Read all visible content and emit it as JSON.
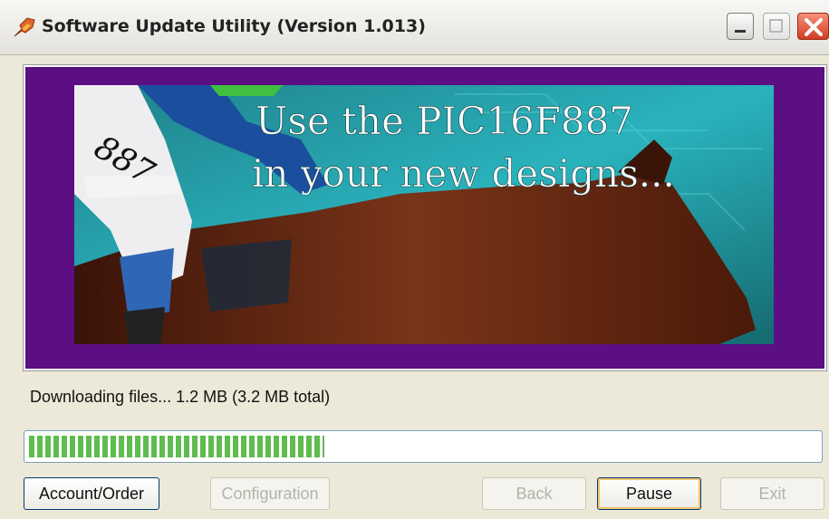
{
  "window": {
    "title": "Software Update Utility (Version 1.013)"
  },
  "banner": {
    "line1": "Use the PIC16F887",
    "line2": "in your new designs...",
    "jersey_number": "887"
  },
  "status": {
    "text": "Downloading files... 1.2 MB (3.2 MB total)",
    "downloaded_mb": 1.2,
    "total_mb": 3.2,
    "progress_fraction": 0.375
  },
  "buttons": {
    "account_order": "Account/Order",
    "configuration": "Configuration",
    "back": "Back",
    "pause": "Pause",
    "exit": "Exit"
  },
  "colors": {
    "banner_border": "#5b0f83",
    "progress_fill": "#5fbc4e",
    "close_button": "#d13c22"
  }
}
